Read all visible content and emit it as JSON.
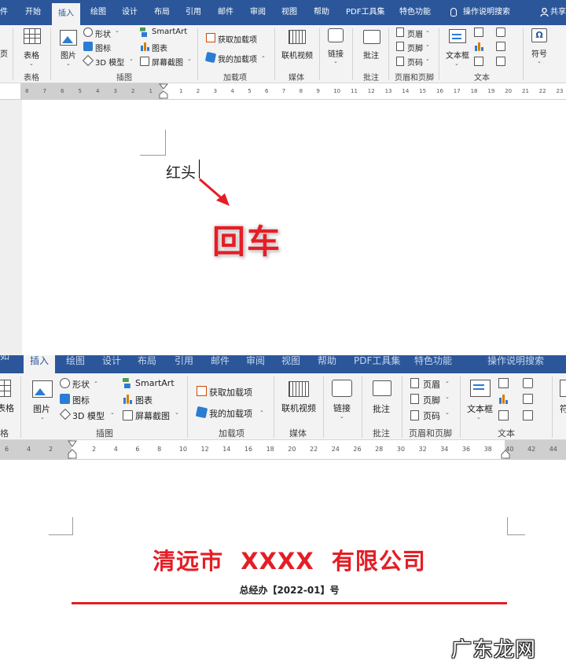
{
  "panel1": {
    "tabs": [
      "件",
      "开始",
      "插入",
      "绘图",
      "设计",
      "布局",
      "引用",
      "邮件",
      "审阅",
      "视图",
      "帮助",
      "PDF工具集",
      "特色功能"
    ],
    "tell_me": "操作说明搜索",
    "share": "共享",
    "ribbon": {
      "left_cut": "页",
      "table": "表格",
      "picture": "图片",
      "shapes": "形状",
      "icons": "图标",
      "model3d": "3D 模型",
      "smartart": "SmartArt",
      "chart": "图表",
      "screenshot": "屏幕截图",
      "get_addins": "获取加载项",
      "my_addins": "我的加载项",
      "online_video": "联机视频",
      "link": "链接",
      "comment": "批注",
      "header": "页眉",
      "footer": "页脚",
      "page_number": "页码",
      "textbox": "文本框",
      "symbol": "符号",
      "group_table": "表格",
      "group_illustrations": "插图",
      "group_addins": "加载项",
      "group_media": "媒体",
      "group_comments": "批注",
      "group_header_footer": "页眉和页脚",
      "group_text": "文本"
    },
    "ruler_left": [
      "8",
      "7",
      "6",
      "5",
      "4",
      "3",
      "2",
      "1"
    ],
    "ruler_right": [
      "1",
      "2",
      "3",
      "4",
      "5",
      "6",
      "7",
      "8",
      "9",
      "10",
      "11",
      "12",
      "13",
      "14",
      "15",
      "16",
      "17",
      "18",
      "19",
      "20",
      "21",
      "22",
      "23"
    ],
    "doc_text": "红头",
    "annotation": "回车"
  },
  "panel2": {
    "tabs_cut": [
      "插入",
      "绘图",
      "设计",
      "布局",
      "引用",
      "邮件",
      "审阅",
      "视图",
      "帮助",
      "PDF工具集",
      "特色功能",
      "操作说明搜索"
    ],
    "ribbon": {
      "table": "表格",
      "picture": "图片",
      "shapes": "形状",
      "icons": "图标",
      "model3d": "3D 模型",
      "smartart": "SmartArt",
      "chart": "图表",
      "screenshot": "屏幕截图",
      "get_addins": "获取加载项",
      "my_addins": "我的加载项",
      "online_video": "联机视频",
      "link": "链接",
      "comment": "批注",
      "header": "页眉",
      "footer": "页脚",
      "page_number": "页码",
      "textbox": "文本框",
      "right_cut": "符",
      "group_table": "格",
      "group_illustrations": "插图",
      "group_addins": "加载项",
      "group_media": "媒体",
      "group_comments": "批注",
      "group_header_footer": "页眉和页脚",
      "group_text": "文本"
    },
    "ruler_left": [
      "6",
      "4",
      "2"
    ],
    "ruler_right": [
      "2",
      "4",
      "6",
      "8",
      "10",
      "12",
      "14",
      "16",
      "18",
      "20",
      "22",
      "24",
      "26",
      "28",
      "30",
      "32",
      "34",
      "36",
      "38",
      "40",
      "42",
      "44"
    ],
    "company": "清远市  XXXX  有限公司",
    "doc_number": "总经办【2022-01】号",
    "colors": {
      "red": "#e41e26"
    }
  },
  "watermark": "广东龙网"
}
